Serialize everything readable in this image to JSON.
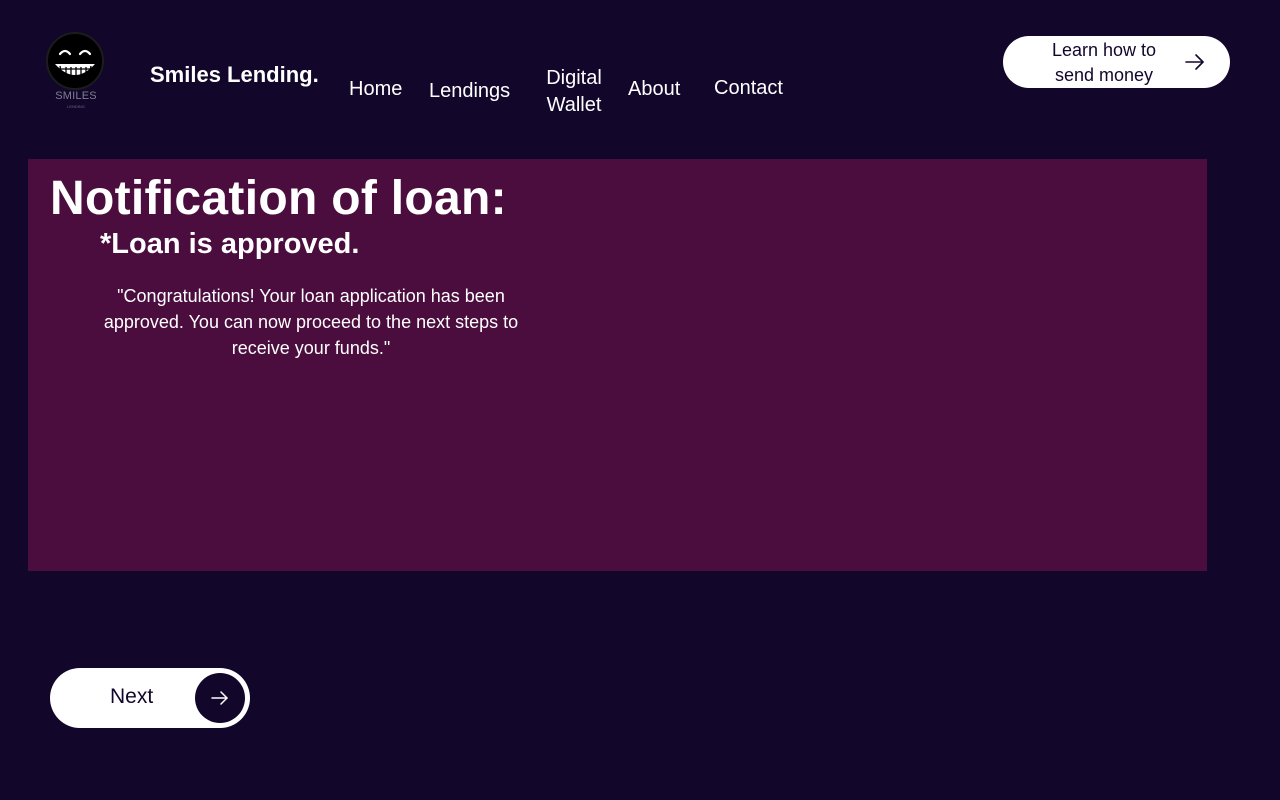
{
  "header": {
    "logo_text": "SMILES",
    "logo_subtext": "LENDING",
    "brand": "Smiles Lending.",
    "nav": {
      "home": "Home",
      "lendings": "Lendings",
      "wallet_line1": "Digital",
      "wallet_line2": "Wallet",
      "about": "About",
      "contact": "Contact"
    },
    "cta_line1": "Learn how to",
    "cta_line2": "send money"
  },
  "notification": {
    "title": "Notification of loan:",
    "status": "*Loan is approved.",
    "message": "\"Congratulations! Your loan application has been approved. You can now proceed to the next steps to receive your funds.\""
  },
  "actions": {
    "next_label": "Next"
  },
  "icons": {
    "logo": "smiley-face-icon",
    "cta": "arrow-right-icon",
    "next": "arrow-right-icon"
  },
  "colors": {
    "background": "#12072b",
    "panel": "#4a0d3e",
    "button": "#ffffff",
    "button_text": "#12072b"
  }
}
